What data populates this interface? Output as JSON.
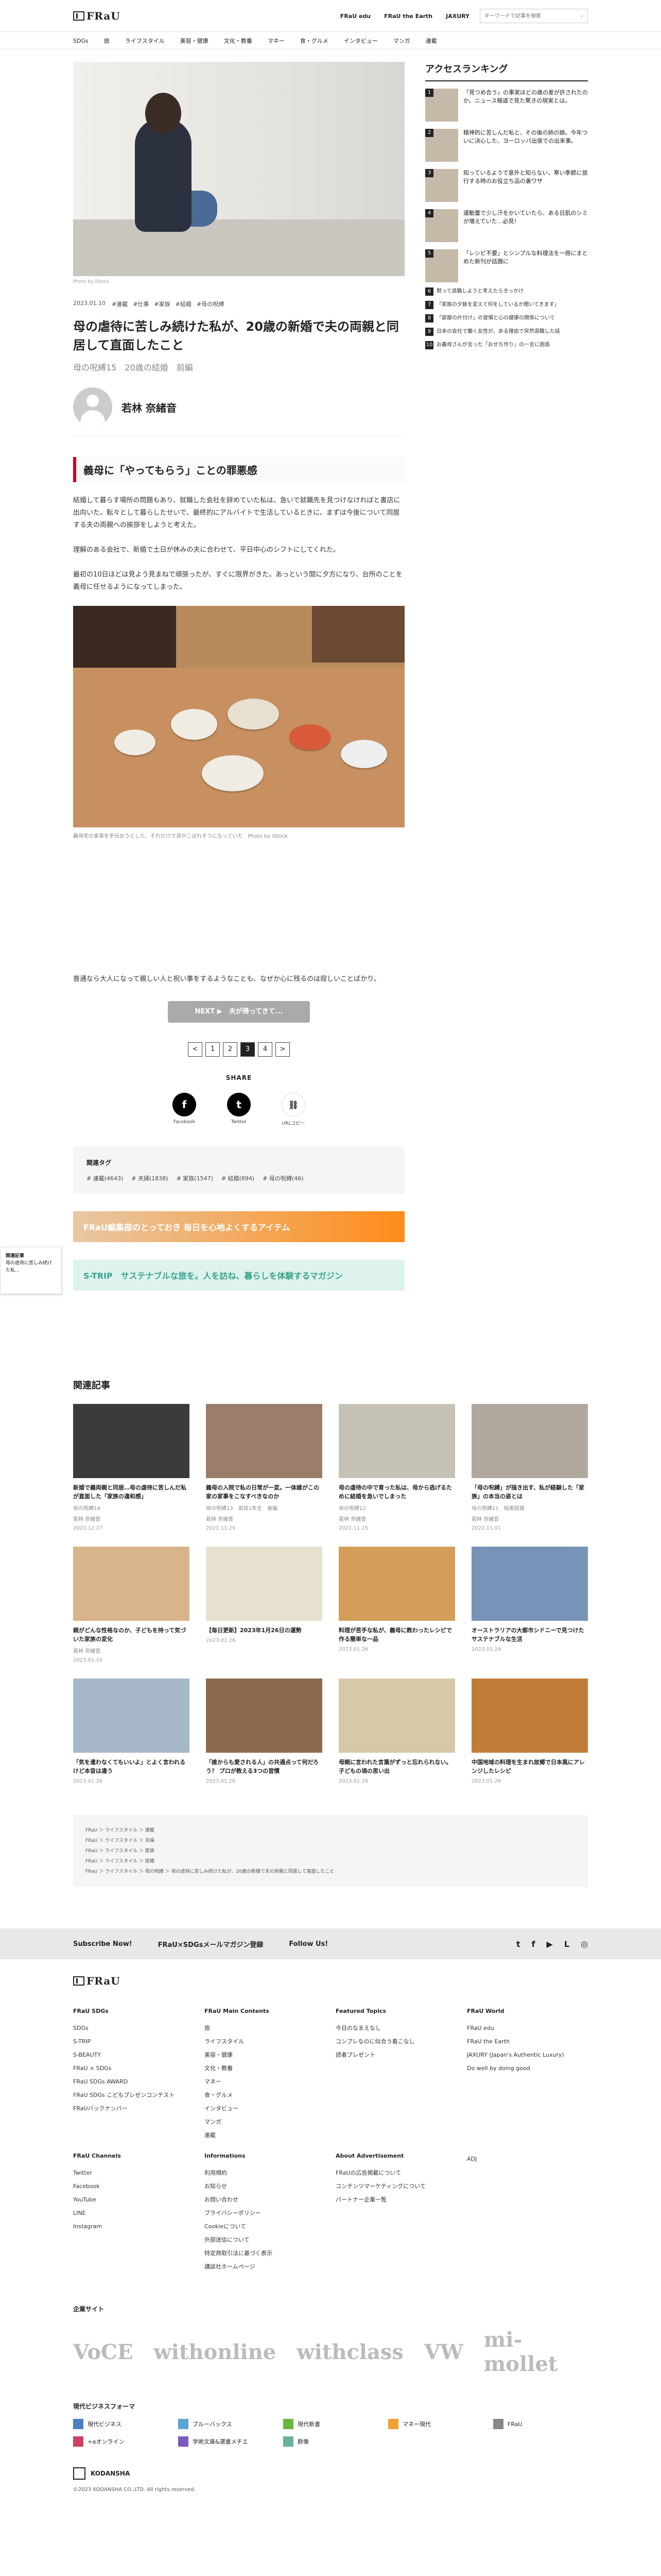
{
  "header": {
    "logo": "FRaU",
    "links": [
      "FRaU edu",
      "FRaU the Earth",
      "JAXURY"
    ],
    "search_placeholder": "キーワードで記事を検索"
  },
  "nav": [
    "SDGs",
    "旅",
    "ライフスタイル",
    "美容・健康",
    "文化・教養",
    "マネー",
    "食・グルメ",
    "インタビュー",
    "マンガ",
    "連載"
  ],
  "article": {
    "photo_caption": "Photo by iStock",
    "date": "2023.01.10",
    "tags": [
      "#連載",
      "#仕事",
      "#家族",
      "#結婚",
      "#母の呪縛"
    ],
    "title": "母の虐待に苦しみ続けた私が、20歳の新婚で夫の両親と同居して直面したこと",
    "subtitle": "母の呪縛15　20歳の結婚　前編",
    "author": "若林 奈緒音",
    "section_heading": "義母に「やってもらう」ことの罪悪感",
    "paragraphs": [
      "結婚して暮らす場所の問題もあり、就職した会社を辞めていた私は、急いで就職先を見つけなければと書店に出向いた。転々として暮らしたせいで、最終的にアルバイトで生活しているときに、まずは今後について同居する夫の両親への挨拶をしようと考えた。",
      "理解のある会社で、新婚で土日が休みの夫に合わせて、平日中心のシフトにしてくれた。",
      "最初の10日ほどは見よう見まねで頑張ったが、すぐに限界がきた。あっという間に夕方になり、台所のことを義母に任せるようになってしまった。"
    ],
    "photo2_caption": "義母宅の食事を手伝おうとした、それだけで涙がこぼれそうになっていた　Photo by iStock",
    "para_after": "普通なら大人になって親しい人と祝い事をするようなことも、なぜか心に残るのは寂しいことばかり。",
    "next_label": "NEXT ▶　夫が帰ってきて...",
    "pages": [
      "<",
      "1",
      "2",
      "3",
      "4",
      ">"
    ],
    "current_page": "3",
    "share_label": "SHARE",
    "share": [
      {
        "icon": "facebook-icon",
        "glyph": "f",
        "label": "Facebook"
      },
      {
        "icon": "twitter-icon",
        "glyph": "t",
        "label": "Twitter"
      },
      {
        "icon": "link-icon",
        "glyph": "⛓",
        "label": "URLコピー"
      }
    ],
    "related_tags_label": "関連タグ",
    "related_tags": [
      "# 連載(4643)",
      "# 夫婦(1838)",
      "# 家族(1547)",
      "# 結婚(894)",
      "# 母の呪縛(46)"
    ],
    "banner1": "FRaU編集部のとっておき 毎日を心地よくするアイテム",
    "banner2": "S-TRIP　サステナブルな旅を。人を訪ね、暮らしを体験するマガジン"
  },
  "sidebar": {
    "heading": "アクセスランキング",
    "items": [
      {
        "n": "1",
        "text": "「見つめ合う」の事実ほどの歳の差が許されたのか。ニュース報道で見た驚きの現実とは。"
      },
      {
        "n": "2",
        "text": "精神的に苦しんだ私と、その後の姉の娘。今年ついに決心した、ヨーロッパ出張での出来事。"
      },
      {
        "n": "3",
        "text": "知っているようで意外と知らない、寒い季節に旅行する時のお役立ち品の裏ワザ"
      },
      {
        "n": "4",
        "text": "運動量で少し汗をかいていたら、ある日肌のシミが増えていた…必見！"
      },
      {
        "n": "5",
        "text": "「レシピ不要」とシンプルな料理法を一冊にまとめた新刊が話題に"
      }
    ],
    "small": [
      {
        "n": "6",
        "text": "黙って退職しようと考えたらきっかけ"
      },
      {
        "n": "7",
        "text": "「家族の夕飯を変えて何をしているか聞いてきます」"
      },
      {
        "n": "8",
        "text": "「部屋の片付け」の習慣と心の健康の関係について"
      },
      {
        "n": "9",
        "text": "日本の会社で働く女性が、ある理由で突然退職した話"
      },
      {
        "n": "10",
        "text": "お義母さんが言った「おせち作り」の一言に困惑"
      }
    ]
  },
  "related": {
    "heading": "関連記事",
    "cards": [
      {
        "title": "新婚で義両親と同居…母の虐待に苦しんだ私が直面した「家族の違和感」",
        "series": "母の呪縛14",
        "author": "若林 奈緒音",
        "date": "2022.12.27"
      },
      {
        "title": "義母の入院で私の日常が一変。一体誰がこの家の家事をこなすべきなのか",
        "series": "母の呪縛13　高校1年生　後編",
        "author": "若林 奈緒音",
        "date": "2022.11.29"
      },
      {
        "title": "母の虐待の中で育った私は、母から逃げるために結婚を急いでしまった",
        "series": "母の呪縛12",
        "author": "若林 奈緒音",
        "date": "2022.11.15"
      },
      {
        "title": "「母の呪縛」が描き出す、私が経験した「家族」の本当の姿とは",
        "series": "母の呪縛11　暗黒結婚",
        "author": "若林 奈緒音",
        "date": "2022.11.01"
      },
      {
        "title": "親がどんな性格なのか、子どもを持って気づいた家族の変化",
        "series": "",
        "author": "若林 奈緒音",
        "date": "2023.01.10"
      },
      {
        "title": "【毎日更新】2023年1月26日の運勢",
        "series": "",
        "author": "",
        "date": "2023.01.26"
      },
      {
        "title": "料理が苦手な私が、義母に教わったレシピで作る簡単な一品",
        "series": "",
        "author": "",
        "date": "2023.01.26"
      },
      {
        "title": "オーストラリアの大都市シドニーで見つけたサステナブルな生活",
        "series": "",
        "author": "",
        "date": "2023.01.26"
      },
      {
        "title": "「気を遣わなくてもいいよ」とよく言われるけど本音は違う",
        "series": "",
        "author": "",
        "date": "2023.01.26"
      },
      {
        "title": "「誰からも愛される人」の共通点って何だろう？ プロが教える3つの習慣",
        "series": "",
        "author": "",
        "date": "2023.01.26"
      },
      {
        "title": "母親に言われた言葉がずっと忘れられない。子どもの頃の思い出",
        "series": "",
        "author": "",
        "date": "2023.01.26"
      },
      {
        "title": "中国地域の料理を生まれ故郷で日本風にアレンジしたレシピ",
        "series": "",
        "author": "",
        "date": "2023.01.26"
      }
    ]
  },
  "breadcrumb": [
    "FRaU ＞ ライフスタイル ＞ 連載",
    "FRaU ＞ ライフスタイル ＞ 夫婦",
    "FRaU ＞ ライフスタイル ＞ 家族",
    "FRaU ＞ ライフスタイル ＞ 結婚",
    "FRaU ＞ ライフスタイル ＞ 母の呪縛 ＞ 母の虐待に苦しみ続けた私が、20歳の新婚で夫の両親と同居して直面したこと"
  ],
  "subscribe": {
    "label": "Subscribe Now!",
    "magazine": "FRaU×SDGsメールマガジン登録",
    "follow": "Follow Us!"
  },
  "footer": {
    "logo": "FRaU",
    "columns": [
      {
        "h": "FRaU SDGs",
        "items": [
          "SDGs",
          "S-TRIP",
          "S-BEAUTY",
          "FRaU × SDGs",
          "FRaU SDGs AWARD",
          "FRaU SDGs こどもプレゼンコンテスト",
          "FRaUバックナンバー"
        ]
      },
      {
        "h": "FRaU Main Contents",
        "items": [
          "旅",
          "ライフスタイル",
          "美容・健康",
          "文化・教養",
          "マネー",
          "食・グルメ",
          "インタビュー",
          "マンガ",
          "連載"
        ]
      },
      {
        "h": "Featured Topics",
        "items": [
          "今日のなまえなし",
          "コンプレなのに似合う着こなし",
          "読者プレゼント"
        ]
      },
      {
        "h": "FRaU World",
        "items": [
          "FRaU edu",
          "FRaU the Earth",
          "JAXURY (Japan's Authentic Luxury)",
          "Do well by doing good"
        ]
      },
      {
        "h": "FRaU Channels",
        "items": [
          "Twitter",
          "Facebook",
          "YouTube",
          "LINE",
          "Instagram"
        ]
      },
      {
        "h": "Informations",
        "items": [
          "利用規約",
          "お知らせ",
          "お問い合わせ",
          "プライバシーポリシー",
          "Cookieについて",
          "外部送信について",
          "特定商取引法に基づく表示",
          "講談社ホームページ"
        ]
      },
      {
        "h": "About Advertisement",
        "items": [
          "FRaUの広告掲載について",
          "コンテンツマーケティングについて",
          "パートナー企業一覧"
        ]
      },
      {
        "h": "",
        "items": [
          "ADJ"
        ]
      }
    ],
    "sites_label": "企業サイト",
    "sites": [
      "VoCE",
      "withonline",
      "withclass",
      "VW",
      "mi-mollet"
    ],
    "biz_label": "現代ビジネスフォーマ",
    "biz": [
      {
        "c": "#4a7fc4",
        "t": "現代ビジネス"
      },
      {
        "c": "#5aa7d6",
        "t": "ブルーバックス"
      },
      {
        "c": "#6db33f",
        "t": "現代新書"
      },
      {
        "c": "#f0a030",
        "t": "マネー現代"
      },
      {
        "c": "#888888",
        "t": "FRaU"
      },
      {
        "c": "#d04060",
        "t": "+αオンライン"
      },
      {
        "c": "#7a5cbf",
        "t": "学術文庫&選書メチエ"
      },
      {
        "c": "#6ab0a0",
        "t": "群像"
      }
    ],
    "kodansha": "KODANSHA",
    "copyright": "©2023 KODANSHA CO.,LTD. All rights reserved."
  },
  "floatbox": {
    "label": "関連記事",
    "text": "母の虐待に苦しみ続けた私…"
  }
}
